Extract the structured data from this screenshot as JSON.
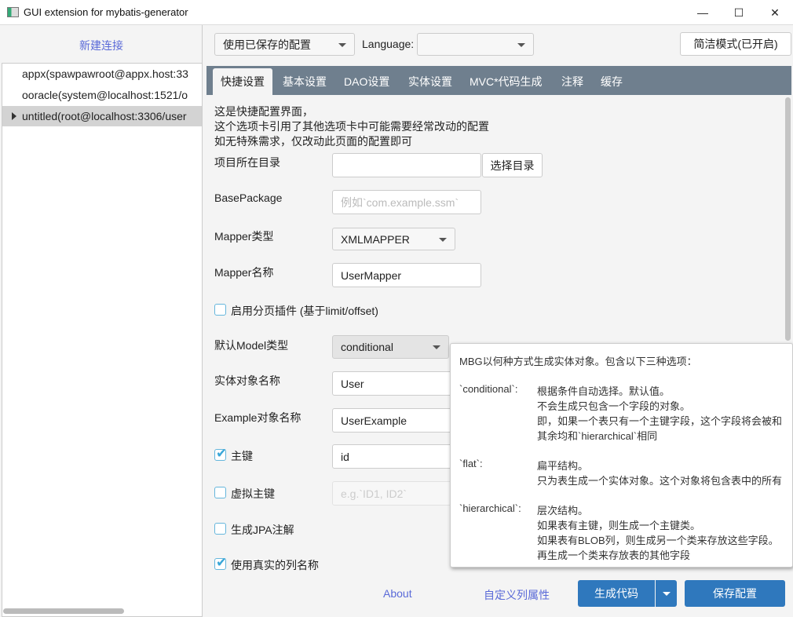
{
  "window": {
    "title": "GUI extension for mybatis-generator",
    "controls": [
      "—",
      "☐",
      "✕"
    ]
  },
  "sidebar": {
    "new_connection": "新建连接",
    "connections": [
      {
        "label": "appx(spawpawroot@appx.host:33",
        "selected": false
      },
      {
        "label": "ooracle(system@localhost:1521/o",
        "selected": false
      },
      {
        "label": "untitled(root@localhost:3306/user",
        "selected": true
      }
    ]
  },
  "toolbar": {
    "saved_config": "使用已保存的配置",
    "language_label": "Language:",
    "language_value": "",
    "simple_mode": "简洁模式(已开启)"
  },
  "tabs": [
    "快捷设置",
    "基本设置",
    "DAO设置",
    "实体设置",
    "MVC*代码生成",
    "注释",
    "缓存"
  ],
  "active_tab": "快捷设置",
  "intro": [
    "这是快捷配置界面，",
    "这个选项卡引用了其他选项卡中可能需要经常改动的配置",
    "如无特殊需求，仅改动此页面的配置即可"
  ],
  "form": {
    "project_dir_label": "项目所在目录",
    "project_dir_value": "",
    "choose_dir": "选择目录",
    "base_package_label": "BasePackage",
    "base_package_placeholder": "例如`com.example.ssm`",
    "mapper_type_label": "Mapper类型",
    "mapper_type_value": "XMLMAPPER",
    "mapper_name_label": "Mapper名称",
    "mapper_name_value": "UserMapper",
    "pagination_label": "启用分页插件 (基于limit/offset)",
    "pagination_checked": false,
    "model_type_label": "默认Model类型",
    "model_type_value": "conditional",
    "entity_name_label": "实体对象名称",
    "entity_name_value": "User",
    "example_name_label": "Example对象名称",
    "example_name_value": "UserExample",
    "pk_label": "主键",
    "pk_checked": true,
    "pk_value": "id",
    "virtual_pk_label": "虚拟主键",
    "virtual_pk_checked": false,
    "virtual_pk_placeholder": "e.g.`ID1, ID2`",
    "jpa_label": "生成JPA注解",
    "jpa_checked": false,
    "real_column_label": "使用真实的列名称",
    "real_column_checked": true
  },
  "footer": {
    "about": "About",
    "custom_columns": "自定义列属性",
    "generate": "生成代码",
    "save": "保存配置"
  },
  "tooltip": {
    "heading": "MBG以何种方式生成实体对象。包含以下三种选项：",
    "conditional_key": "`conditional`:",
    "conditional_lines": [
      "根据条件自动选择。默认值。",
      "不会生成只包含一个字段的对象。",
      "即，如果一个表只有一个主键字段，这个字段将会被和",
      "其余均和`hierarchical`相同"
    ],
    "flat_key": "`flat`:",
    "flat_lines": [
      "扁平结构。",
      "只为表生成一个实体对象。这个对象将包含表中的所有"
    ],
    "hierarchical_key": "`hierarchical`:",
    "hierarchical_lines": [
      "层次结构。",
      "如果表有主键，则生成一个主键类。",
      "如果表有BLOB列，则生成另一个类来存放这些字段。",
      "再生成一个类来存放表的其他字段"
    ]
  },
  "colors": {
    "tabbar": "#6f7f8e",
    "primary": "#2f78bd",
    "link": "#5a6ad8",
    "checkbox": "#3aa7d8"
  }
}
